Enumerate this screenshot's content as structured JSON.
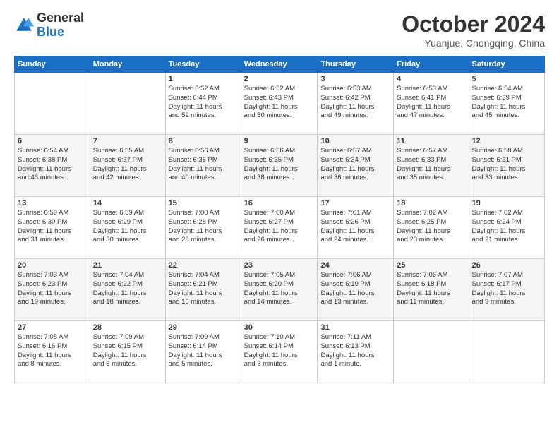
{
  "header": {
    "logo_line1": "General",
    "logo_line2": "Blue",
    "month_title": "October 2024",
    "location": "Yuanjue, Chongqing, China"
  },
  "weekdays": [
    "Sunday",
    "Monday",
    "Tuesday",
    "Wednesday",
    "Thursday",
    "Friday",
    "Saturday"
  ],
  "weeks": [
    [
      {
        "day": "",
        "detail": ""
      },
      {
        "day": "",
        "detail": ""
      },
      {
        "day": "1",
        "detail": "Sunrise: 6:52 AM\nSunset: 6:44 PM\nDaylight: 11 hours\nand 52 minutes."
      },
      {
        "day": "2",
        "detail": "Sunrise: 6:52 AM\nSunset: 6:43 PM\nDaylight: 11 hours\nand 50 minutes."
      },
      {
        "day": "3",
        "detail": "Sunrise: 6:53 AM\nSunset: 6:42 PM\nDaylight: 11 hours\nand 49 minutes."
      },
      {
        "day": "4",
        "detail": "Sunrise: 6:53 AM\nSunset: 6:41 PM\nDaylight: 11 hours\nand 47 minutes."
      },
      {
        "day": "5",
        "detail": "Sunrise: 6:54 AM\nSunset: 6:39 PM\nDaylight: 11 hours\nand 45 minutes."
      }
    ],
    [
      {
        "day": "6",
        "detail": "Sunrise: 6:54 AM\nSunset: 6:38 PM\nDaylight: 11 hours\nand 43 minutes."
      },
      {
        "day": "7",
        "detail": "Sunrise: 6:55 AM\nSunset: 6:37 PM\nDaylight: 11 hours\nand 42 minutes."
      },
      {
        "day": "8",
        "detail": "Sunrise: 6:56 AM\nSunset: 6:36 PM\nDaylight: 11 hours\nand 40 minutes."
      },
      {
        "day": "9",
        "detail": "Sunrise: 6:56 AM\nSunset: 6:35 PM\nDaylight: 11 hours\nand 38 minutes."
      },
      {
        "day": "10",
        "detail": "Sunrise: 6:57 AM\nSunset: 6:34 PM\nDaylight: 11 hours\nand 36 minutes."
      },
      {
        "day": "11",
        "detail": "Sunrise: 6:57 AM\nSunset: 6:33 PM\nDaylight: 11 hours\nand 35 minutes."
      },
      {
        "day": "12",
        "detail": "Sunrise: 6:58 AM\nSunset: 6:31 PM\nDaylight: 11 hours\nand 33 minutes."
      }
    ],
    [
      {
        "day": "13",
        "detail": "Sunrise: 6:59 AM\nSunset: 6:30 PM\nDaylight: 11 hours\nand 31 minutes."
      },
      {
        "day": "14",
        "detail": "Sunrise: 6:59 AM\nSunset: 6:29 PM\nDaylight: 11 hours\nand 30 minutes."
      },
      {
        "day": "15",
        "detail": "Sunrise: 7:00 AM\nSunset: 6:28 PM\nDaylight: 11 hours\nand 28 minutes."
      },
      {
        "day": "16",
        "detail": "Sunrise: 7:00 AM\nSunset: 6:27 PM\nDaylight: 11 hours\nand 26 minutes."
      },
      {
        "day": "17",
        "detail": "Sunrise: 7:01 AM\nSunset: 6:26 PM\nDaylight: 11 hours\nand 24 minutes."
      },
      {
        "day": "18",
        "detail": "Sunrise: 7:02 AM\nSunset: 6:25 PM\nDaylight: 11 hours\nand 23 minutes."
      },
      {
        "day": "19",
        "detail": "Sunrise: 7:02 AM\nSunset: 6:24 PM\nDaylight: 11 hours\nand 21 minutes."
      }
    ],
    [
      {
        "day": "20",
        "detail": "Sunrise: 7:03 AM\nSunset: 6:23 PM\nDaylight: 11 hours\nand 19 minutes."
      },
      {
        "day": "21",
        "detail": "Sunrise: 7:04 AM\nSunset: 6:22 PM\nDaylight: 11 hours\nand 18 minutes."
      },
      {
        "day": "22",
        "detail": "Sunrise: 7:04 AM\nSunset: 6:21 PM\nDaylight: 11 hours\nand 16 minutes."
      },
      {
        "day": "23",
        "detail": "Sunrise: 7:05 AM\nSunset: 6:20 PM\nDaylight: 11 hours\nand 14 minutes."
      },
      {
        "day": "24",
        "detail": "Sunrise: 7:06 AM\nSunset: 6:19 PM\nDaylight: 11 hours\nand 13 minutes."
      },
      {
        "day": "25",
        "detail": "Sunrise: 7:06 AM\nSunset: 6:18 PM\nDaylight: 11 hours\nand 11 minutes."
      },
      {
        "day": "26",
        "detail": "Sunrise: 7:07 AM\nSunset: 6:17 PM\nDaylight: 11 hours\nand 9 minutes."
      }
    ],
    [
      {
        "day": "27",
        "detail": "Sunrise: 7:08 AM\nSunset: 6:16 PM\nDaylight: 11 hours\nand 8 minutes."
      },
      {
        "day": "28",
        "detail": "Sunrise: 7:09 AM\nSunset: 6:15 PM\nDaylight: 11 hours\nand 6 minutes."
      },
      {
        "day": "29",
        "detail": "Sunrise: 7:09 AM\nSunset: 6:14 PM\nDaylight: 11 hours\nand 5 minutes."
      },
      {
        "day": "30",
        "detail": "Sunrise: 7:10 AM\nSunset: 6:14 PM\nDaylight: 11 hours\nand 3 minutes."
      },
      {
        "day": "31",
        "detail": "Sunrise: 7:11 AM\nSunset: 6:13 PM\nDaylight: 11 hours\nand 1 minute."
      },
      {
        "day": "",
        "detail": ""
      },
      {
        "day": "",
        "detail": ""
      }
    ]
  ]
}
